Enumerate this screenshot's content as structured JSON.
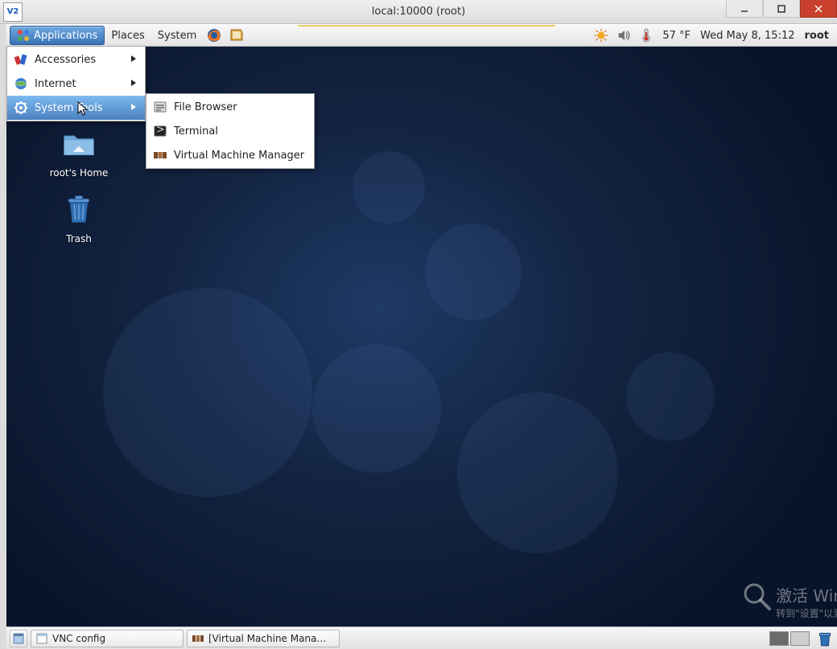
{
  "window": {
    "title": "local:10000 (root)",
    "vnc_logo_text": "V2"
  },
  "panel": {
    "applications": "Applications",
    "places": "Places",
    "system": "System",
    "temperature": "57 °F",
    "datetime": "Wed May  8, 15:12",
    "user": "root"
  },
  "applications_menu": {
    "items": [
      {
        "label": "Accessories",
        "icon": "accessories"
      },
      {
        "label": "Internet",
        "icon": "internet"
      },
      {
        "label": "System Tools",
        "icon": "systemtools",
        "hover": true
      }
    ]
  },
  "system_tools_submenu": {
    "items": [
      {
        "label": "File Browser",
        "icon": "filebrowser"
      },
      {
        "label": "Terminal",
        "icon": "terminal"
      },
      {
        "label": "Virtual Machine Manager",
        "icon": "vmm"
      }
    ]
  },
  "desktop_icons": {
    "home": "root's Home",
    "trash": "Trash"
  },
  "taskbar": {
    "tasks": [
      {
        "label": "VNC config"
      },
      {
        "label": "[Virtual Machine Mana…"
      }
    ]
  },
  "watermark": {
    "line1": "激活 Win",
    "line2": "转到\"设置\"以激"
  }
}
